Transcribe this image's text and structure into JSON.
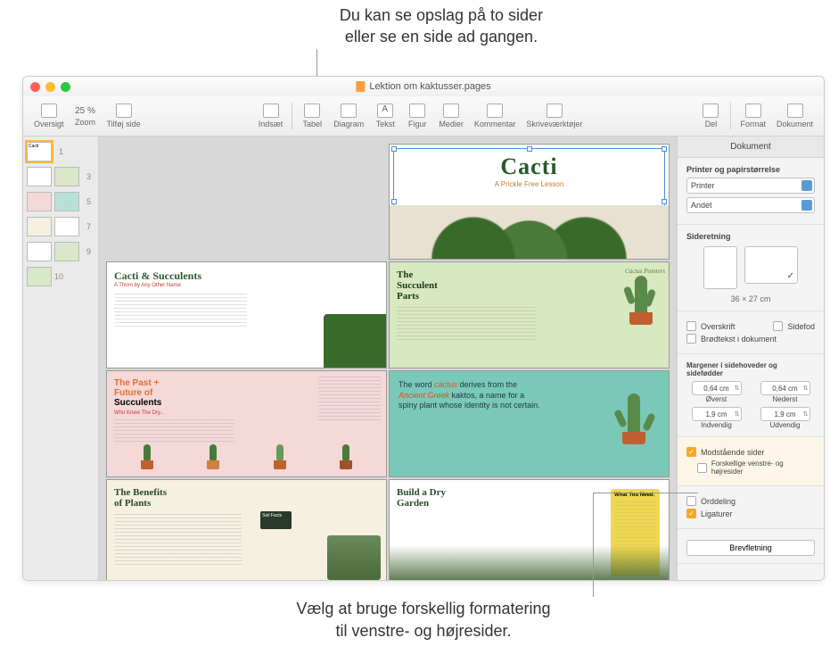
{
  "callouts": {
    "top": "Du kan se opslag på to sider\neller se en side ad gangen.",
    "bottom": "Vælg at bruge forskellig formatering\ntil venstre- og højresider."
  },
  "window": {
    "title": "Lektion om kaktusser.pages"
  },
  "toolbar": {
    "view": "Oversigt",
    "zoom": "25 %",
    "zoom_label": "Zoom",
    "add_page": "Tilføj side",
    "insert": "Indsæt",
    "table": "Tabel",
    "chart": "Diagram",
    "text": "Tekst",
    "shape": "Figur",
    "media": "Medier",
    "comment": "Kommentar",
    "collab": "Skriveværktøjer",
    "share": "Del",
    "format": "Format",
    "document": "Dokument"
  },
  "thumbs": [
    {
      "num": "1",
      "label": "Cacti"
    },
    {
      "num": "3"
    },
    {
      "num": "5"
    },
    {
      "num": "7"
    },
    {
      "num": "9"
    },
    {
      "num": "10"
    }
  ],
  "pages": {
    "hero_title": "Cacti",
    "hero_sub": "A Prickle Free Lesson",
    "p2_title": "Cacti & Succulents",
    "p2_sub": "A Thorn by Any Other Name",
    "p3_title": "The\nSucculent\nParts",
    "p3_side": "Cactus Pointers",
    "p4_title_a": "The Past +\nFuture of",
    "p4_title_b": "Succulents",
    "p4_sub": "Who Knew The Dry...",
    "p5_text_a": "The word ",
    "p5_text_b": "cactus",
    "p5_text_c": " derives from the ",
    "p5_text_d": "Ancient Greek",
    "p5_text_e": " kaktos, a name for a spiny plant whose identity is not certain.",
    "p6_title": "The Benefits\nof Plants",
    "p7_title": "Build a Dry\nGarden",
    "p7_yellow_title": "What You Need:"
  },
  "inspector": {
    "header": "Dokument",
    "printer_section": "Printer og papirstørrelse",
    "printer": "Printer",
    "paper": "Andet",
    "orientation": "Sideretning",
    "size": "36 × 27 cm",
    "header_chk": "Overskrift",
    "footer_chk": "Sidefod",
    "body_chk": "Brødtekst i dokument",
    "margins_label": "Margener i sidehoveder og sidefødder",
    "margin_top": "0,64 cm",
    "margin_top_label": "Øverst",
    "margin_bottom": "0,64 cm",
    "margin_bottom_label": "Nederst",
    "margin_inner": "1,9 cm",
    "margin_inner_label": "Indvendig",
    "margin_outer": "1,9 cm",
    "margin_outer_label": "Udvendig",
    "facing": "Modstående sider",
    "diff_lr": "Forskellige venstre- og højresider",
    "hyphen": "Orddeling",
    "ligatures": "Ligaturer",
    "mailmerge": "Brevfletning"
  }
}
